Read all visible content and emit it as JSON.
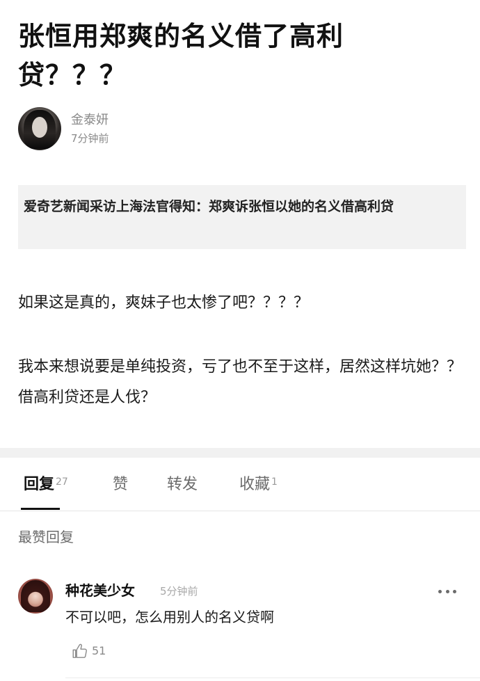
{
  "post": {
    "title": "张恒用郑爽的名义借了高利贷？？？",
    "author": {
      "name": "金泰妍",
      "time": "7分钟前"
    },
    "quote": "爱奇艺新闻采访上海法官得知：郑爽诉张恒以她的名义借高利贷",
    "paragraphs": [
      "如果这是真的，爽妹子也太惨了吧？？？？",
      "我本来想说要是单纯投资，亏了也不至于这样，居然这样坑她？？借高利贷还是人伐？"
    ]
  },
  "tabs": [
    {
      "label": "回复",
      "count": "27",
      "active": true
    },
    {
      "label": "赞",
      "count": "",
      "active": false
    },
    {
      "label": "转发",
      "count": "",
      "active": false
    },
    {
      "label": "收藏",
      "count": "1",
      "active": false
    }
  ],
  "replies_section": {
    "label": "最赞回复",
    "items": [
      {
        "name": "种花美少女",
        "time": "5分钟前",
        "text": "不可以吧，怎么用别人的名义贷啊",
        "likes": "51"
      }
    ]
  },
  "icons": {
    "more": "more-dots-icon",
    "like": "thumbs-up-icon"
  }
}
